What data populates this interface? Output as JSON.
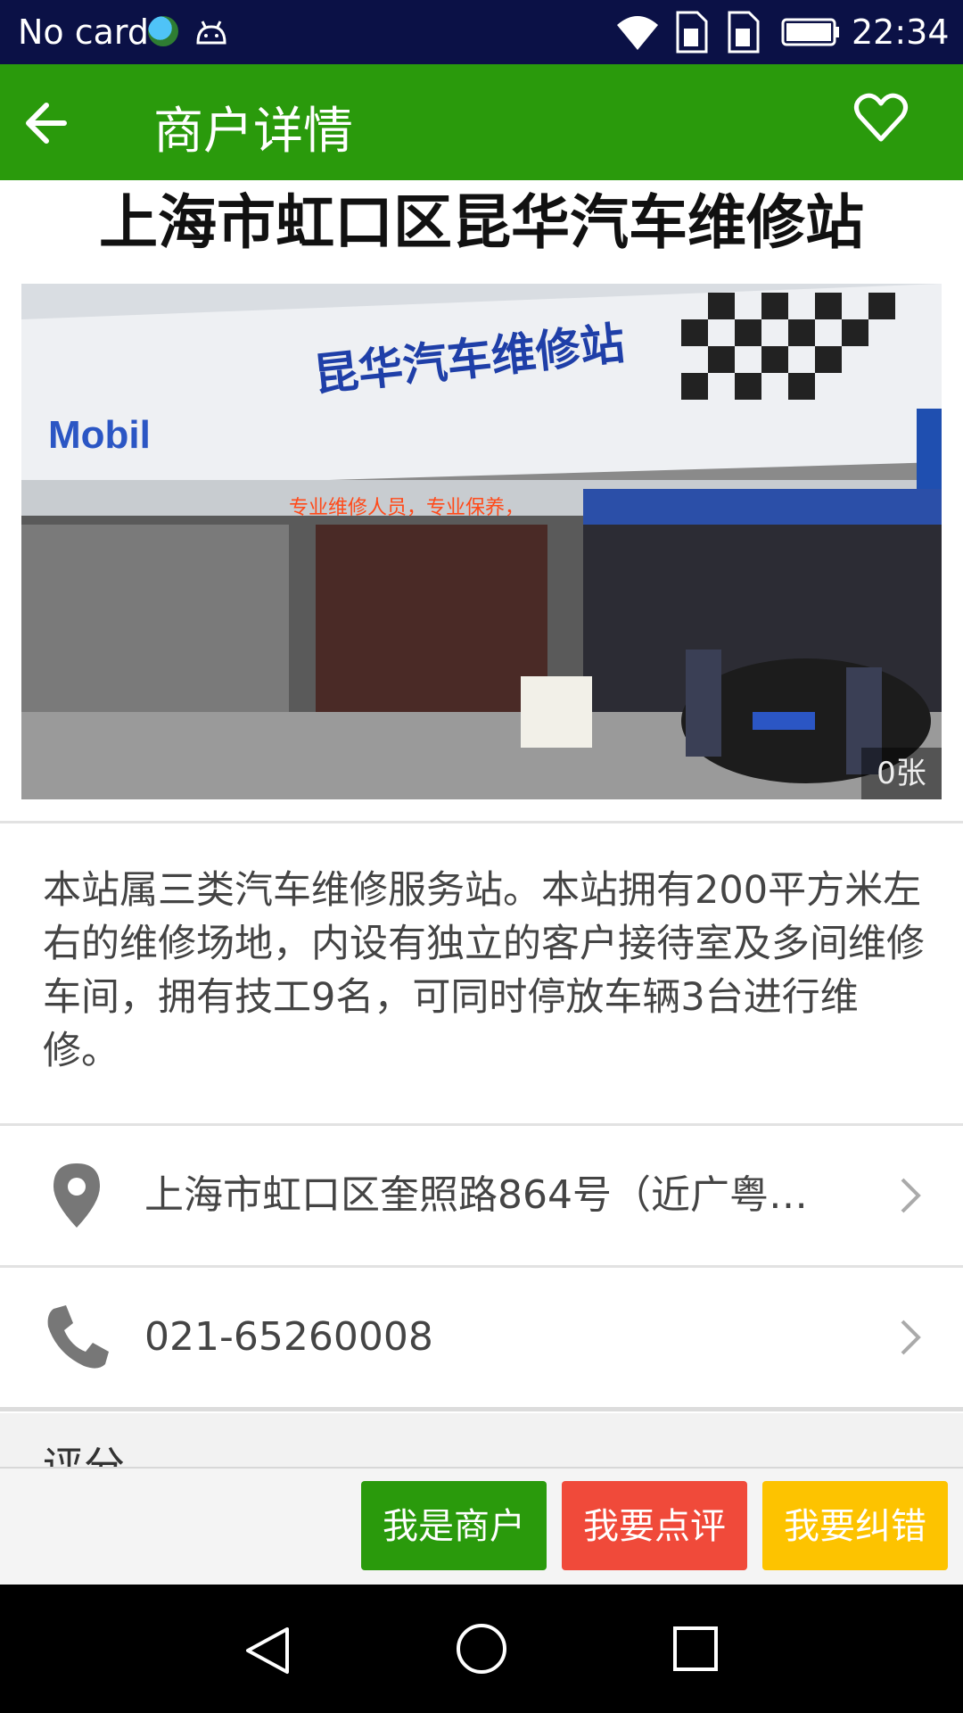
{
  "status_bar": {
    "carrier": "No card",
    "time": "22:34",
    "icons": [
      "globe-icon",
      "android-icon",
      "wifi-icon",
      "sim-icon",
      "sim-icon",
      "battery-icon"
    ]
  },
  "app_bar": {
    "title": "商户详情",
    "back_icon": "arrow-left-icon",
    "favorite_icon": "heart-outline-icon",
    "color": "#2a9a0c"
  },
  "shop": {
    "name": "上海市虹口区昆华汽车维修站",
    "photo": {
      "sign_text": "昆华汽车维修站",
      "brand_text": "Mobil",
      "led_text": "专业维修人员，专业保养，",
      "count_label": "0张"
    },
    "description": "本站属三类汽车维修服务站。本站拥有200平方米左右的维修场地，内设有独立的客户接待室及多间维修车间，拥有技工9名，可同时停放车辆3台进行维修。",
    "address": "上海市虹口区奎照路864号（近广粤…",
    "phone": "021-65260008"
  },
  "rating": {
    "label": "评分"
  },
  "actions": {
    "merchant_label": "我是商户",
    "review_label": "我要点评",
    "correct_label": "我要纠错",
    "colors": {
      "merchant": "#2a9a0c",
      "review": "#f04a3a",
      "correct": "#fdc300"
    }
  },
  "nav_bar": {
    "icons": [
      "back-triangle-icon",
      "home-circle-icon",
      "recents-square-icon"
    ]
  }
}
